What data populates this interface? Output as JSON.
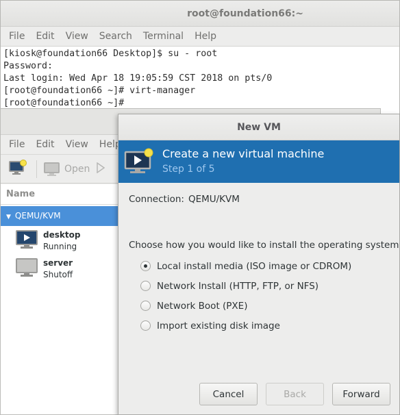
{
  "terminal": {
    "title": "root@foundation66:~",
    "menu": [
      "File",
      "Edit",
      "View",
      "Search",
      "Terminal",
      "Help"
    ],
    "lines": [
      "[kiosk@foundation66 Desktop]$ su - root",
      "Password:",
      "Last login: Wed Apr 18 19:05:59 CST 2018 on pts/0",
      "[root@foundation66 ~]# virt-manager",
      "[root@foundation66 ~]#"
    ]
  },
  "vmm": {
    "menu": [
      "File",
      "Edit",
      "View",
      "Help"
    ],
    "toolbar": {
      "open_label": "Open"
    },
    "list_header": "Name",
    "connection": "QEMU/KVM",
    "vms": [
      {
        "name": "desktop",
        "status": "Running",
        "icon": "monitor-running-icon"
      },
      {
        "name": "server",
        "status": "Shutoff",
        "icon": "monitor-off-icon"
      }
    ]
  },
  "dialog": {
    "title": "New VM",
    "banner_title": "Create a new virtual machine",
    "banner_step": "Step 1 of 5",
    "connection_label": "Connection:",
    "connection_value": "QEMU/KVM",
    "choose_prompt": "Choose how you would like to install the operating system",
    "options": [
      {
        "label": "Local install media (ISO image or CDROM)",
        "checked": true
      },
      {
        "label": "Network Install (HTTP, FTP, or NFS)",
        "checked": false
      },
      {
        "label": "Network Boot (PXE)",
        "checked": false
      },
      {
        "label": "Import existing disk image",
        "checked": false
      }
    ],
    "buttons": {
      "cancel": "Cancel",
      "back": "Back",
      "forward": "Forward"
    }
  },
  "colors": {
    "banner_bg": "#1f6fb0",
    "selection_bg": "#4a90d9",
    "step_text": "#9ec7ee"
  }
}
